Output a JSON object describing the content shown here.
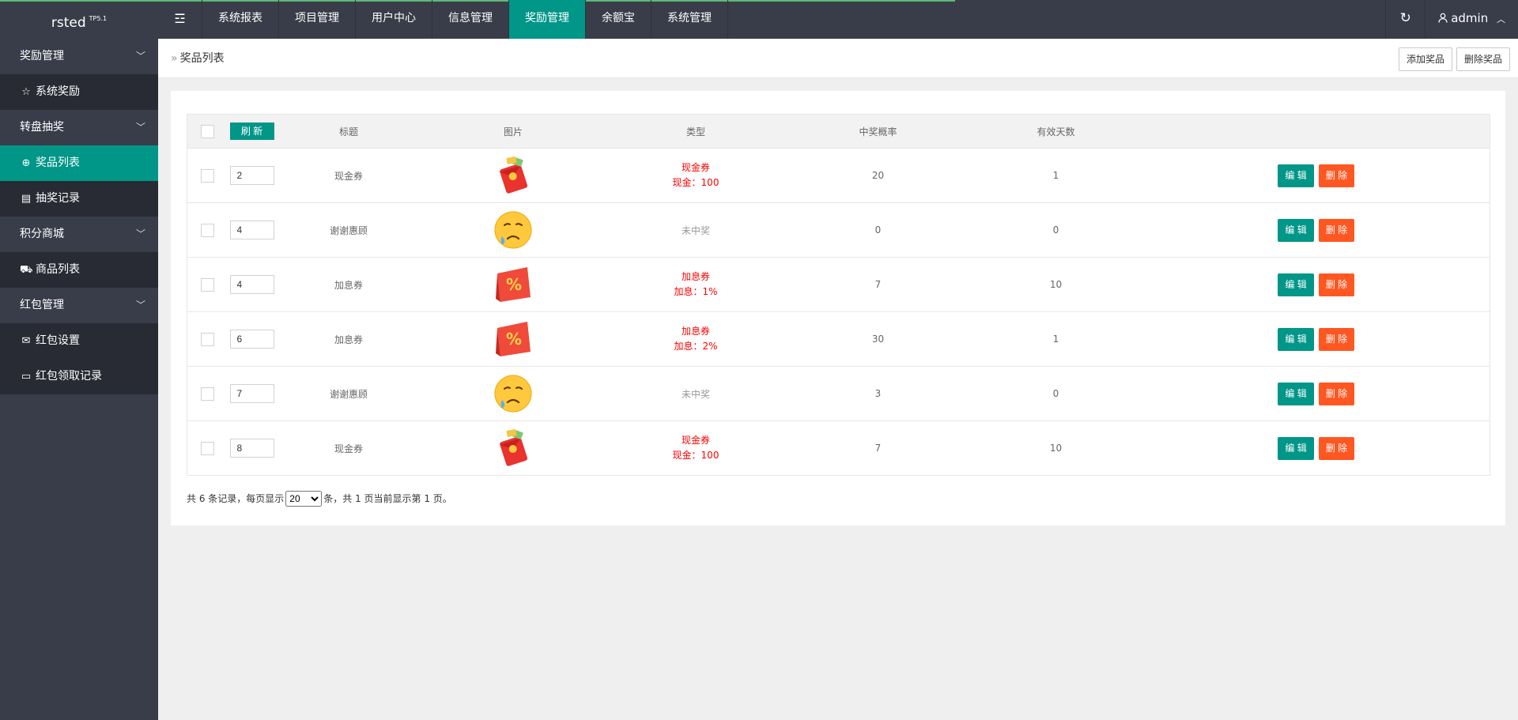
{
  "app": {
    "logo": "rsted",
    "logo_sup": "TP5.1"
  },
  "header": {
    "toggle_icon": "☲",
    "nav": [
      "系统报表",
      "项目管理",
      "用户中心",
      "信息管理",
      "奖励管理",
      "余额宝",
      "系统管理"
    ],
    "active_nav": "奖励管理",
    "refresh_icon": "↻",
    "user": "admin",
    "user_icon": "person-icon",
    "colors": {
      "header_bg": "#393d49",
      "accent": "#009688",
      "danger": "#ff5722"
    }
  },
  "sidebar": {
    "groups": [
      {
        "label": "奖励管理",
        "items": [
          {
            "label": "系统奖励",
            "icon": "star-icon"
          }
        ]
      },
      {
        "label": "转盘抽奖",
        "items": [
          {
            "label": "奖品列表",
            "icon": "globe-icon",
            "active": true
          },
          {
            "label": "抽奖记录",
            "icon": "clipboard-icon"
          }
        ]
      },
      {
        "label": "积分商城",
        "items": [
          {
            "label": "商品列表",
            "icon": "cart-icon"
          }
        ]
      },
      {
        "label": "红包管理",
        "items": [
          {
            "label": "红包设置",
            "icon": "envelope-icon"
          },
          {
            "label": "红包领取记录",
            "icon": "card-icon"
          }
        ]
      }
    ]
  },
  "breadcrumb": {
    "arrow": "»",
    "label": "奖品列表"
  },
  "toolbar": {
    "add_label": "添加奖品",
    "delete_label": "删除奖品"
  },
  "table": {
    "refresh_label": "刷 新",
    "headers": [
      "标题",
      "图片",
      "类型",
      "中奖概率",
      "有效天数"
    ],
    "rows": [
      {
        "sort": "2",
        "title": "现金券",
        "image": "redpacket",
        "type1": "现金券",
        "type2": "现金：100",
        "prob": "20",
        "days": "1"
      },
      {
        "sort": "4",
        "title": "谢谢惠顾",
        "image": "sad",
        "type1": "未中奖",
        "type2": "",
        "prob": "0",
        "days": "0"
      },
      {
        "sort": "4",
        "title": "加息券",
        "image": "percent",
        "type1": "加息券",
        "type2": "加息：1%",
        "prob": "7",
        "days": "10"
      },
      {
        "sort": "6",
        "title": "加息券",
        "image": "percent",
        "type1": "加息券",
        "type2": "加息：2%",
        "prob": "30",
        "days": "1"
      },
      {
        "sort": "7",
        "title": "谢谢惠顾",
        "image": "sad",
        "type1": "未中奖",
        "type2": "",
        "prob": "3",
        "days": "0"
      },
      {
        "sort": "8",
        "title": "现金券",
        "image": "redpacket",
        "type1": "现金券",
        "type2": "现金：100",
        "prob": "7",
        "days": "10"
      }
    ],
    "edit_label": "编 辑",
    "delete_label": "删 除"
  },
  "pager": {
    "prefix": "共 6 条记录，每页显示",
    "page_size": "20",
    "suffix": "条，共 1 页当前显示第 1 页。"
  }
}
